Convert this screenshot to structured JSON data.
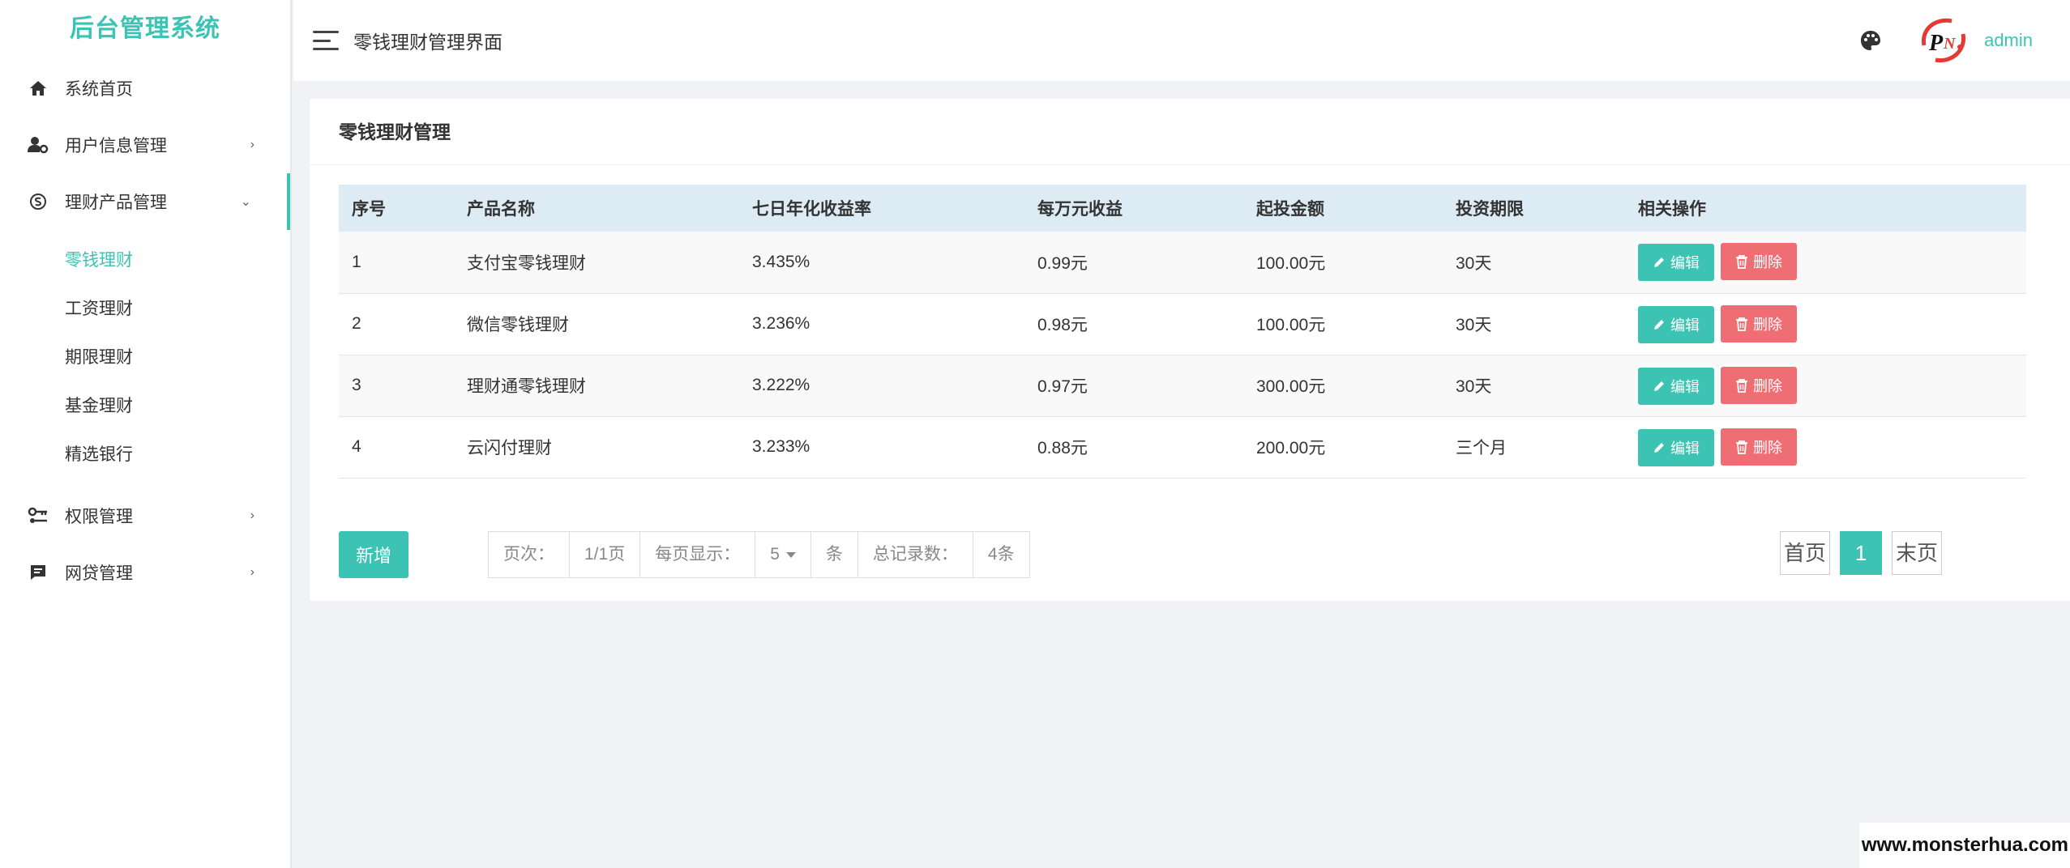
{
  "brand": "后台管理系统",
  "header": {
    "title": "零钱理财管理界面",
    "username": "admin"
  },
  "sidebar": {
    "items": [
      {
        "label": "系统首页",
        "icon": "home-icon"
      },
      {
        "label": "用户信息管理",
        "icon": "user-gear-icon"
      },
      {
        "label": "理财产品管理",
        "icon": "skype-icon"
      },
      {
        "label": "权限管理",
        "icon": "key-icon"
      },
      {
        "label": "网贷管理",
        "icon": "message-icon"
      }
    ],
    "sub_items": [
      "零钱理财",
      "工资理财",
      "期限理财",
      "基金理财",
      "精选银行"
    ]
  },
  "panel": {
    "title": "零钱理财管理"
  },
  "table": {
    "headers": [
      "序号",
      "产品名称",
      "七日年化收益率",
      "每万元收益",
      "起投金额",
      "投资期限",
      "相关操作"
    ],
    "rows": [
      [
        "1",
        "支付宝零钱理财",
        "3.435%",
        "0.99元",
        "100.00元",
        "30天"
      ],
      [
        "2",
        "微信零钱理财",
        "3.236%",
        "0.98元",
        "100.00元",
        "30天"
      ],
      [
        "3",
        "理财通零钱理财",
        "3.222%",
        "0.97元",
        "300.00元",
        "30天"
      ],
      [
        "4",
        "云闪付理财",
        "3.233%",
        "0.88元",
        "200.00元",
        "三个月"
      ]
    ],
    "edit_label": "编辑",
    "delete_label": "删除"
  },
  "footer": {
    "add_label": "新增",
    "page_label": "页次：",
    "page_value": "1/1页",
    "per_page_label": "每页显示：",
    "per_page_value": "5",
    "per_page_unit": "条",
    "total_label": "总记录数：",
    "total_value": "4条",
    "first_label": "首页",
    "current_page": "1",
    "last_label": "末页"
  },
  "watermark": "www.monsterhua.com",
  "colors": {
    "accent": "#3cc3b4",
    "danger": "#ee6e73",
    "table_header": "#ddebf5"
  }
}
